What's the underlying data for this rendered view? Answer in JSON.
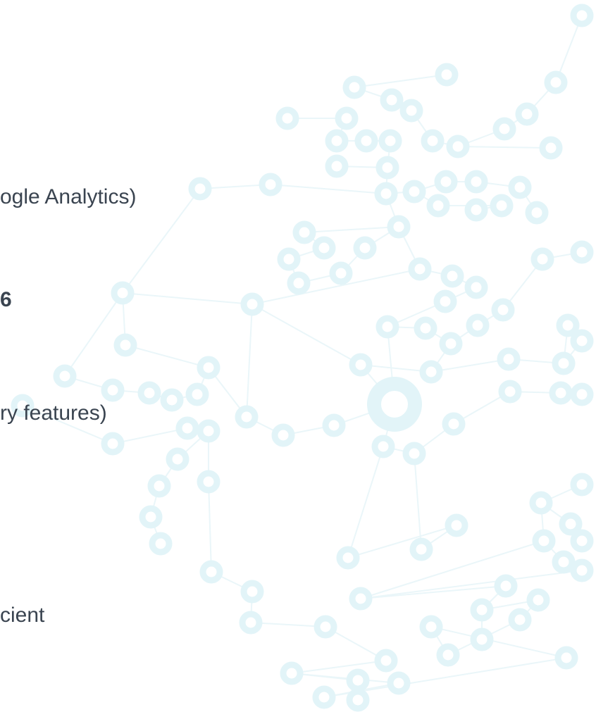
{
  "theme": {
    "text_color": "#3a4450",
    "network_node_color": "#e2f4f8",
    "network_edge_color": "#eaf6f9"
  },
  "background": {
    "icon": "network-graph-illustration"
  },
  "content": {
    "lines": [
      {
        "text": "ogle Analytics)"
      },
      {
        "text": "6"
      },
      {
        "text": "ry features)"
      },
      {
        "text": "cient"
      }
    ]
  }
}
